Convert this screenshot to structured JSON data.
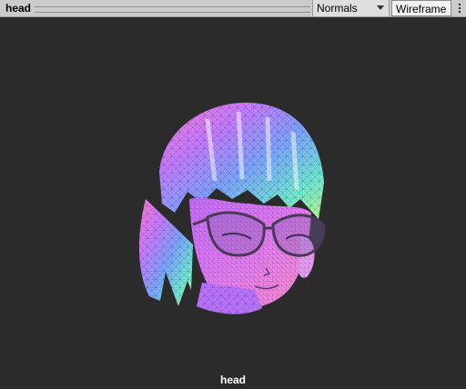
{
  "toolbar": {
    "title": "head",
    "shading_mode": "Normals",
    "wireframe_label": "Wireframe"
  },
  "viewport": {
    "caption": "head"
  },
  "icons": {
    "dropdown": "chevron-down-icon",
    "menu": "kebab-menu-icon"
  }
}
